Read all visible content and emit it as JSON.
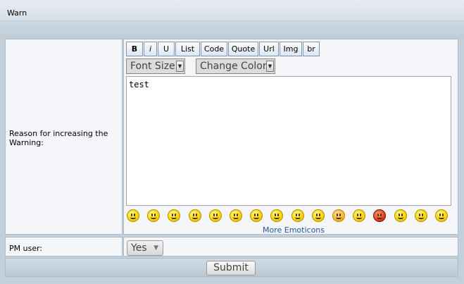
{
  "window": {
    "title": "Warn"
  },
  "form": {
    "reason_label": "Reason for increasing the Warning:",
    "pm_label": "PM user:",
    "submit_label": "Submit"
  },
  "toolbar": {
    "buttons": [
      {
        "id": "bold",
        "label": "B"
      },
      {
        "id": "italic",
        "label": "i"
      },
      {
        "id": "underline",
        "label": "U"
      },
      {
        "id": "list",
        "label": "List"
      },
      {
        "id": "code",
        "label": "Code"
      },
      {
        "id": "quote",
        "label": "Quote"
      },
      {
        "id": "url",
        "label": "Url"
      },
      {
        "id": "img",
        "label": "Img"
      },
      {
        "id": "br",
        "label": "br"
      }
    ],
    "font_size_label": "Font Size",
    "change_color_label": "Change Color"
  },
  "message": {
    "value": "test"
  },
  "emoticons": {
    "icons": [
      "smile-icon",
      "wink-icon",
      "grin-icon",
      "tongue-icon",
      "neutral-icon",
      "sad-icon",
      "happy-icon",
      "confused-icon",
      "surprised-icon",
      "cool-icon",
      "angel-icon",
      "eyes-roll-icon",
      "angry-icon",
      "shock-icon",
      "laugh-icon",
      "sunglasses-icon"
    ],
    "more_label": "More Emoticons"
  },
  "pm_user": {
    "selected": "Yes"
  },
  "colors": {
    "page_bg": "#c3d0dc",
    "cell_bg": "#f4f6f9",
    "link": "#225599"
  }
}
